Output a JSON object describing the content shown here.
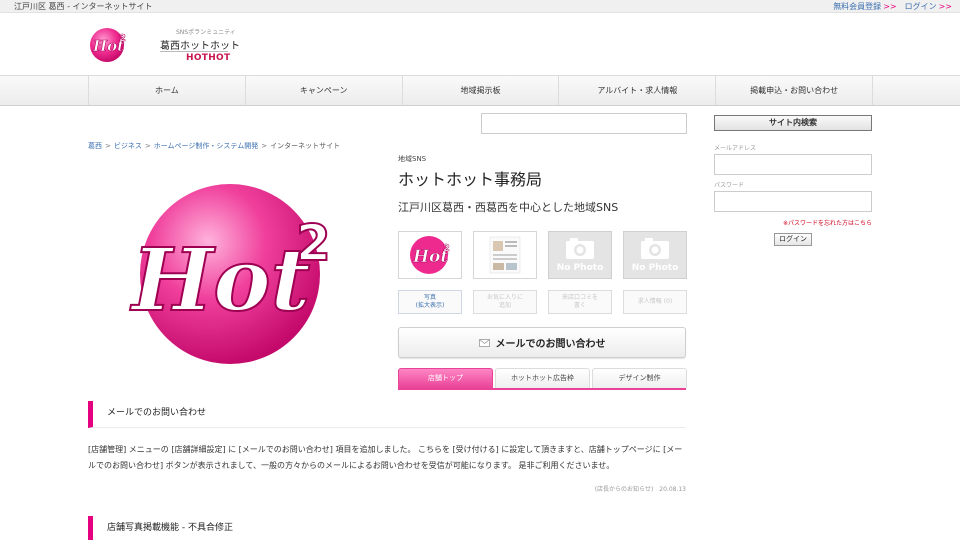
{
  "topbar": {
    "caption": "江戸川区 葛西 - インターネットサイト",
    "links": [
      {
        "label": "無料会員登録",
        "arrow": ">>"
      },
      {
        "label": "ログイン",
        "arrow": ">>"
      }
    ]
  },
  "header": {
    "tagline": "SNSポランミュニティ",
    "brand_name": "葛西ホットホット",
    "brand_en": "HOTHOT"
  },
  "nav": {
    "items": [
      "ホーム",
      "キャンペーン",
      "地域掲示板",
      "アルバイト・求人情報",
      "掲載申込・お問い合わせ"
    ]
  },
  "breadcrumb": {
    "links": [
      "葛西",
      "ビジネス",
      "ホームページ制作・システム開発"
    ],
    "separator": ">",
    "current": "インターネットサイト"
  },
  "shop": {
    "category": "地域SNS",
    "title": "ホットホット事務局",
    "subtitle": "江戸川区葛西・西葛西を中心とした地域SNS",
    "nophoto_label": "No Photo",
    "actions": [
      "写真\n(拡大表示)",
      "お気に入りに\n追加",
      "来店口コミを\n書く",
      "求人情報 (0)"
    ],
    "mail_button": "メールでのお問い合わせ",
    "tabs": [
      "店舗トップ",
      "ホットホット広告枠",
      "デザイン制作"
    ]
  },
  "sections": [
    {
      "title": "メールでのお問い合わせ",
      "body": "[店舗管理] メニューの [店舗詳細設定] に [メールでのお問い合わせ] 項目を追加しました。 こちらを [受け付ける] に設定して頂きますと、店舗トップページに [メールでのお問い合わせ] ボタンが表示されまして、一般の方々からのメールによるお問い合わせを受信が可能になります。 是非ご利用くださいませ。",
      "meta": "(店長からのお知らせ)　20.08.13"
    },
    {
      "title": "店舗写真掲載機能 - 不具合修正"
    }
  ],
  "sidebar": {
    "title": "サイト内検索",
    "email_label": "メールアドレス",
    "password_label": "パスワード",
    "forgot": "※パスワードを忘れた方はこちら",
    "login_button": "ログイン"
  },
  "logo_text": {
    "main": "Hot",
    "sup": "2"
  },
  "colors": {
    "brand_pink": "#e4007f",
    "link_blue": "#3b6fb0",
    "brand_en_red": "#c8174f",
    "warn_red": "#d0021b"
  }
}
